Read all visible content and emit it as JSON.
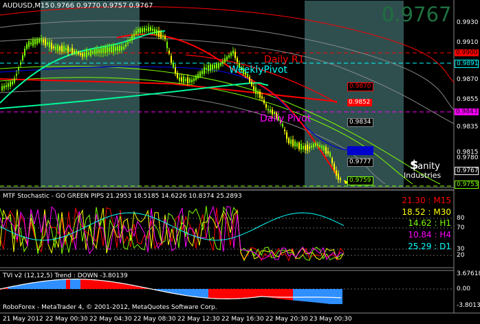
{
  "header": {
    "symbol": "AUDUSD,M15",
    "ohlc": "0.9766 0.9770 0.9757 0.9767",
    "big_price": "0.9767"
  },
  "price_scale": [
    "0.9930",
    "0.9910",
    "0.9890",
    "0.9870",
    "0.9855",
    "0.9835",
    "0.9815",
    "0.9795",
    "0.9780",
    "0.9760"
  ],
  "price_tags": {
    "r_0_9900": "0.9900",
    "r_0_9891": "0.9891",
    "r_0_9870": "0.9870",
    "r_0_9852": "0.9852",
    "r_0_9843": "0.9843",
    "r_0_9834": "0.9834",
    "r_0_9805": "0.9805",
    "r_0_9777": "0.9777",
    "r_0_9767": "0.9767",
    "r_0_9759": "0.9759",
    "r_0_9753": "0.9753"
  },
  "labels": {
    "daily_r1": "Daily R1",
    "weekly_pivot": "WeeklyPivot",
    "daily_pivot": "Daily Pivot",
    "watermark_line1": "Sanity",
    "watermark_line2": "Industries"
  },
  "stochastic": {
    "title": "MTF Stochastic - GO GREEN PIPS 21.2953 18.5185 14.6226 10.8374 25.2893",
    "levels": [
      "80",
      "70",
      "30",
      "20"
    ],
    "rows": [
      {
        "text": "21.30 : M15",
        "color": "#ff0000"
      },
      {
        "text": "18.52 : M30",
        "color": "#ffff00"
      },
      {
        "text": "14.62 : H1",
        "color": "#7cfc00"
      },
      {
        "text": "10.84 : H4",
        "color": "#ff00ff"
      },
      {
        "text": "25.29 : D1",
        "color": "#00ffff"
      }
    ]
  },
  "tvi": {
    "title": "TVI v2 (12,12,5) Trend : DOWN -3.80139",
    "scale": [
      "3.67618",
      "0.00",
      "-3.80139"
    ]
  },
  "footer": "RoboForex - MetaTrader 4, © 2001-2012, MetaQuotes Software Corp.",
  "time_axis": [
    "21 May 2012",
    "22 May 00:30",
    "22 May 04:30",
    "22 May 08:30",
    "22 May 12:30",
    "22 May 16:30",
    "22 May 20:30",
    "23 May 00:30"
  ],
  "colors": {
    "background": "#000000",
    "session_shade": "#2f4f4f",
    "bull_candle": "#7cfc00",
    "bear_candle": "#ffff00",
    "ma_fast": "#00fa9a",
    "ma_slow": "#0000cd",
    "resistance": "#ff0000",
    "pivot": "#ff00ff",
    "tvi_up": "#2f8fff",
    "tvi_down": "#ff0000"
  }
}
